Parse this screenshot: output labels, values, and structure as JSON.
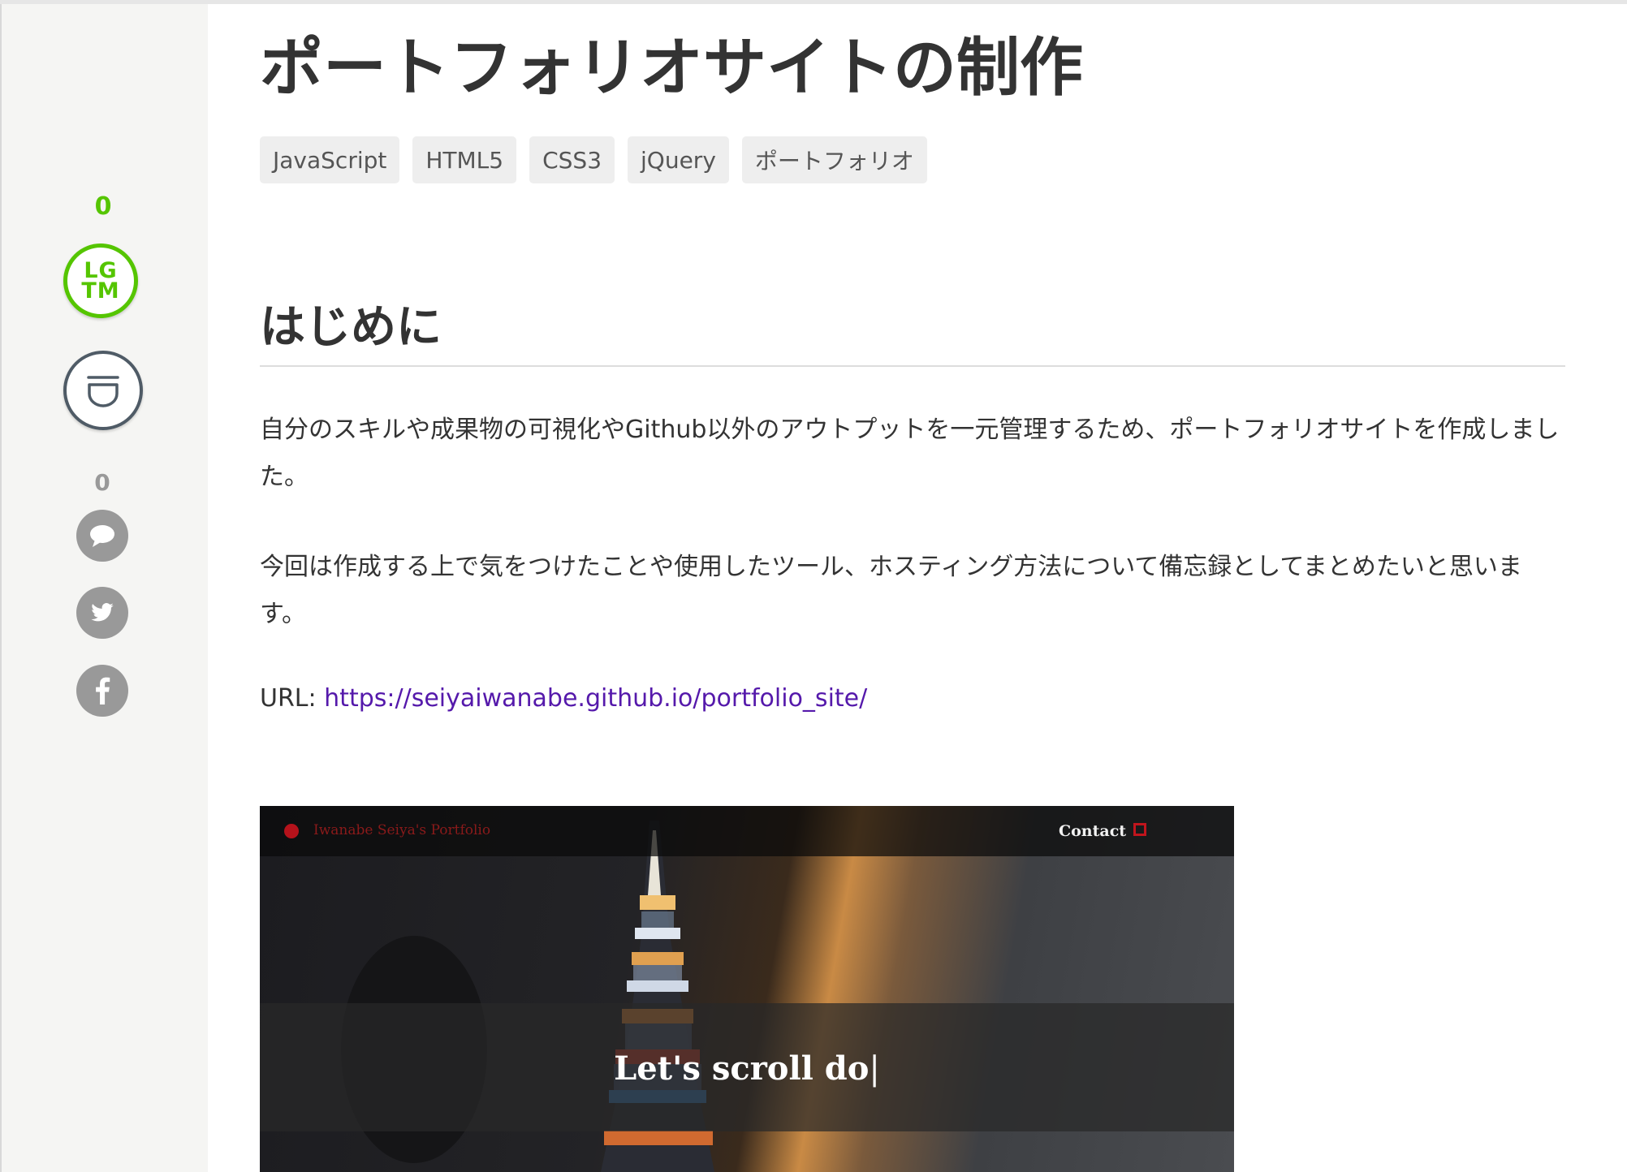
{
  "sidebar": {
    "like_count": "0",
    "lgtm_line1": "LG",
    "lgtm_line2": "TM",
    "comment_count": "0",
    "icons": [
      "lgtm-icon",
      "stock-icon",
      "comment-icon",
      "twitter-icon",
      "facebook-icon"
    ]
  },
  "article": {
    "title": "ポートフォリオサイトの制作",
    "tags": [
      "JavaScript",
      "HTML5",
      "CSS3",
      "jQuery",
      "ポートフォリオ"
    ],
    "section_heading": "はじめに",
    "paragraph1": "自分のスキルや成果物の可視化やGithub以外のアウトプットを一元管理するため、ポートフォリオサイトを作成しました。",
    "paragraph2": "今回は作成する上で気をつけたことや使用したツール、ホスティング方法について備忘録としてまとめたいと思います。",
    "url_label": "URL:",
    "url": "https://seiyaiwanabe.github.io/portfolio_site/"
  },
  "screenshot": {
    "brand": "Iwanabe Seiya's Portfolio",
    "contact": "Contact",
    "banner_text": "Let's scroll do"
  },
  "colors": {
    "accent_green": "#55c500",
    "link_purple": "#5519ab",
    "stock_border": "#4f5b66",
    "social_gray": "#999999"
  }
}
